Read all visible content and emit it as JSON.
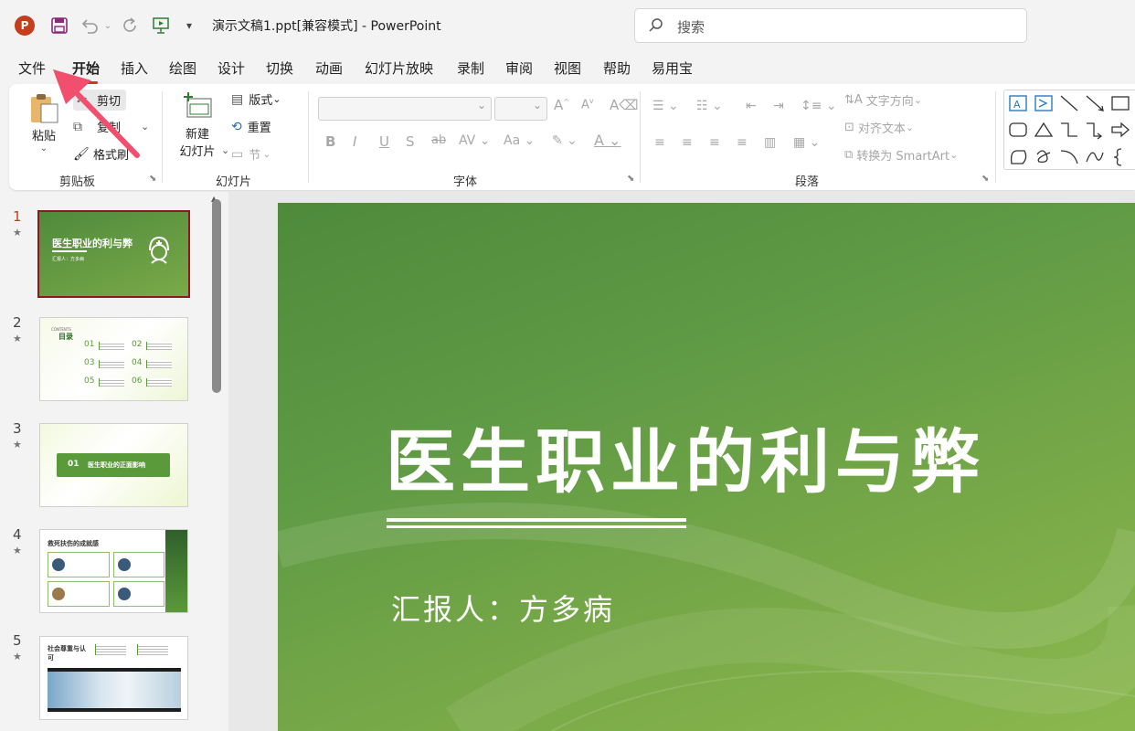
{
  "window": {
    "title": "演示文稿1.ppt[兼容模式]  -  PowerPoint",
    "app_logo": "P",
    "search_placeholder": "搜索"
  },
  "tabs": [
    "文件",
    "开始",
    "插入",
    "绘图",
    "设计",
    "切换",
    "动画",
    "幻灯片放映",
    "录制",
    "审阅",
    "视图",
    "帮助",
    "易用宝"
  ],
  "active_tab": "开始",
  "ribbon": {
    "clipboard": {
      "label": "剪贴板",
      "paste": "粘贴",
      "cut": "剪切",
      "copy": "复制",
      "format_painter": "格式刷"
    },
    "slides": {
      "label": "幻灯片",
      "new_slide_line1": "新建",
      "new_slide_line2": "幻灯片",
      "layout": "版式",
      "reset": "重置",
      "section": "节"
    },
    "font": {
      "label": "字体",
      "bold": "B",
      "italic": "I",
      "underline": "U",
      "shadow": "S",
      "strike": "ab",
      "spacing": "AV",
      "case": "Aa",
      "grow": "A",
      "shrink": "A"
    },
    "paragraph": {
      "label": "段落",
      "text_direction": "文字方向",
      "align_text": "对齐文本",
      "smartart": "转换为 SmartArt"
    }
  },
  "slides": [
    {
      "number": "1",
      "title": "医生职业的利与弊",
      "subtitle": "汇报人：方多病"
    },
    {
      "number": "2",
      "title": "目录",
      "heading": "CONTENTS",
      "items": [
        "01",
        "02",
        "03",
        "04",
        "05",
        "06"
      ]
    },
    {
      "number": "3",
      "title": "医生职业的正面影响",
      "index": "01"
    },
    {
      "number": "4",
      "title": "救死扶伤的成就感"
    },
    {
      "number": "5",
      "title": "社会尊重与认可"
    }
  ],
  "main_slide": {
    "title": "医生职业的利与弊",
    "subtitle": "汇报人：方多病"
  },
  "colors": {
    "accent": "#c43e1c",
    "slide_green": "#5f9a45",
    "annotation_arrow": "#f0506e"
  }
}
